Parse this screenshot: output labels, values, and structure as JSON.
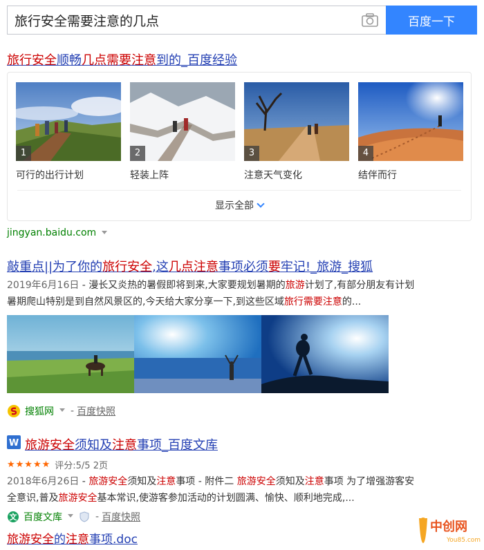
{
  "search": {
    "query": "旅行安全需要注意的几点",
    "button_label": "百度一下"
  },
  "result1": {
    "title_parts": [
      "旅行安全",
      "顺畅",
      "几点需要注意",
      "到的_百度经验"
    ],
    "thumbnails": [
      {
        "num": "1",
        "caption": "可行的出行计划"
      },
      {
        "num": "2",
        "caption": "轻装上阵"
      },
      {
        "num": "3",
        "caption": "注意天气变化"
      },
      {
        "num": "4",
        "caption": "结伴而行"
      }
    ],
    "show_all_label": "显示全部",
    "source": "jingyan.baidu.com"
  },
  "result2": {
    "title_parts": [
      "敲重点||为了你的",
      "旅行安全",
      ",这",
      "几点注意",
      "事项必须",
      "要",
      "牢记!_旅游_搜狐"
    ],
    "date": "2019年6月16日",
    "snippet_line1_parts": [
      " - 漫长又炎热的暑假即将到来,大家要规划暑期的",
      "旅游",
      "计划了,有部分朋友有计划"
    ],
    "snippet_line2_parts": [
      "暑期爬山特别是到自然风景区的,今天给大家分享一下,到这些区域",
      "旅行需要注意",
      "的..."
    ],
    "source_name": "搜狐网",
    "snapshot_label": "百度快照"
  },
  "result3": {
    "title_parts": [
      "旅游安全",
      "须知及",
      "注意",
      "事项_百度文库"
    ],
    "rating_text": "评分:5/5 2页",
    "date": "2018年6月26日",
    "snippet_line1_parts": [
      " - ",
      "旅游安全",
      "须知及",
      "注意",
      "事项 - 附件二 ",
      "旅游安全",
      "须知及",
      "注意",
      "事项 为了增强游客安"
    ],
    "snippet_line2_parts": [
      "全意识,普及",
      "旅游安全",
      "基本常识,使游客参加活动的计划圆满、愉快、顺利地完成,..."
    ],
    "source_name": "百度文库",
    "snapshot_label": "百度快照",
    "sub_link_parts": [
      "旅游安全",
      "的",
      "注意",
      "事项.doc"
    ]
  },
  "watermark": {
    "brand": "中创网",
    "domain": "You85.com"
  },
  "colors": {
    "link": "#2440b3",
    "highlight": "#cc0000",
    "url_green": "#008000",
    "button_blue": "#3385ff",
    "star_orange": "#ff6600"
  }
}
